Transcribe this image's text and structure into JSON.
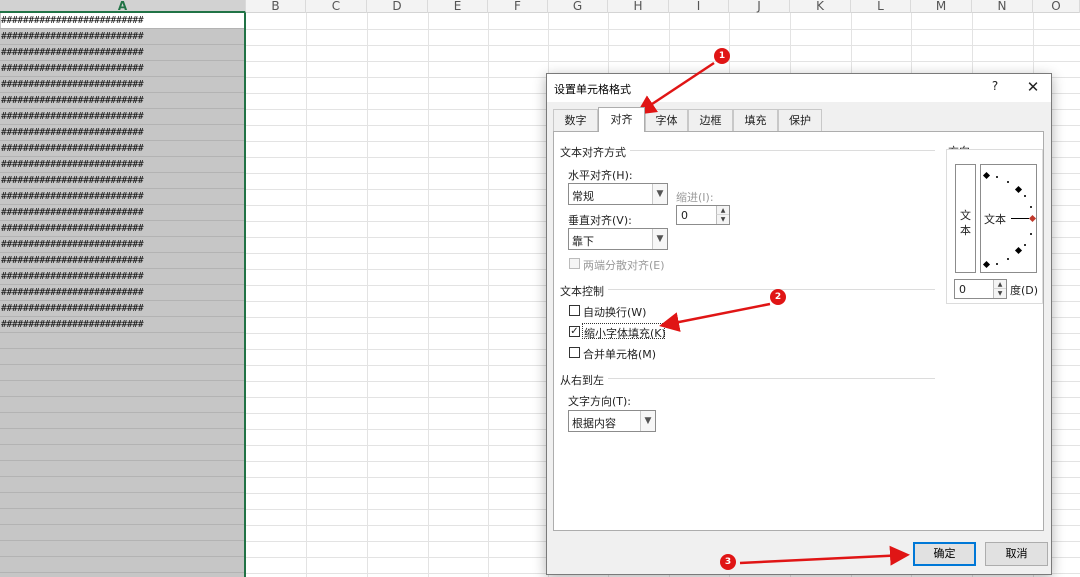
{
  "sheet": {
    "columns": [
      "A",
      "B",
      "C",
      "D",
      "E",
      "F",
      "G",
      "H",
      "I",
      "J",
      "K",
      "L",
      "M",
      "N",
      "O"
    ],
    "selected_column": "A",
    "cell_hash_text": "##########################"
  },
  "dialog": {
    "title": "设置单元格格式",
    "help": "?",
    "close": "✕",
    "tabs": [
      {
        "label": "数字"
      },
      {
        "label": "对齐"
      },
      {
        "label": "字体"
      },
      {
        "label": "边框"
      },
      {
        "label": "填充"
      },
      {
        "label": "保护"
      }
    ],
    "active_tab": "对齐",
    "text_alignment": {
      "group_title": "文本对齐方式",
      "horizontal_label": "水平对齐(H):",
      "horizontal_value": "常规",
      "indent_label": "缩进(I):",
      "indent_value": "0",
      "vertical_label": "垂直对齐(V):",
      "vertical_value": "靠下",
      "justify_distributed_label": "两端分散对齐(E)",
      "justify_distributed_checked": false
    },
    "text_control": {
      "group_title": "文本控制",
      "wrap_text_label": "自动换行(W)",
      "wrap_text_checked": false,
      "shrink_to_fit_label": "缩小字体填充(K)",
      "shrink_to_fit_checked": true,
      "merge_cells_label": "合并单元格(M)",
      "merge_cells_checked": false
    },
    "rtl": {
      "group_title": "从右到左",
      "direction_label": "文字方向(T):",
      "direction_value": "根据内容"
    },
    "orientation": {
      "group_title": "方向",
      "vertical_text": [
        "文",
        "本"
      ],
      "dial_text": "文本",
      "degrees_value": "0",
      "degrees_label": "度(D)"
    },
    "ok_label": "确定",
    "cancel_label": "取消"
  },
  "annotations": {
    "badges": [
      "1",
      "2",
      "3"
    ],
    "color": "#e01515"
  },
  "colors": {
    "excel_green": "#217346",
    "selected_column_fill": "#c6c6c6",
    "dialog_bg": "#f0f0f0",
    "focus_blue": "#0078d7"
  }
}
